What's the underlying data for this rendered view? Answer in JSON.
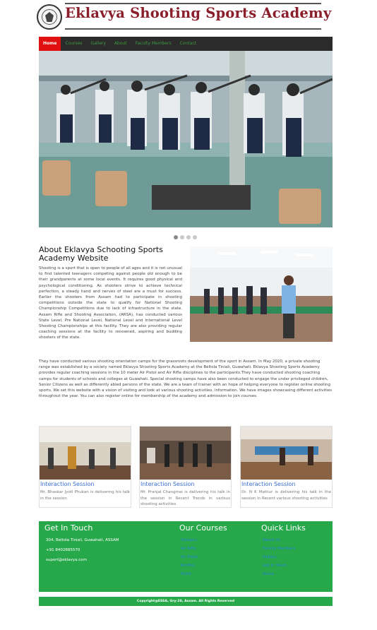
{
  "header": {
    "title": "Eklavya Shooting Sports Academy"
  },
  "nav": {
    "items": [
      "Home",
      "Courses",
      "Gallery",
      "About",
      "Faculty Members",
      "Contact"
    ],
    "active_index": 0
  },
  "slider": {
    "slide_count": 4,
    "active_index": 0
  },
  "about": {
    "heading": "About Eklavya Schooting Sports Academy Website",
    "para1": "Shooting is a sport that is open to people of all ages and it is not unusual to find talented teenagers competing against people old enough to be their grandparents at some local events. It requires good physical and psychological conditioning. As shooters strive to achieve technical perfection, a steady hand and nerves of steel are a must for success. Earlier the shooters from Assam had to participate in shooting competitions outside the state to qualify for National Shooting Championship Competitions due to lack of infrastructure in the state. Assam Rifle and Shooting Association, (ARSA), has conducted various State Level, Pre National Level, National Level and International Level Shooting Championships at this facility. They are also providing regular coaching sessions at the facility to renowned, aspiring and budding shooters of the state.",
    "para2": "They have conducted various shooting orientation camps for the grassroots development of the sport in Assam. In May 2020, a private shooting range was established by a society named Eklavya Shooting Sports Academy at the Beltola Tiniali, Guwahati. Eklavya Shooting Sports Academy provides regular coaching sessions in the 10 meter Air Pistol and Air Rifle disciplines to the participants.They have conducted shooting coaching camps for students of schools and colleges at Guwahati. Special shooting camps have also been conducted to engage the under privileged children, Senior Citizens as well as differently abled persons of the state. We are a team of trainer with an hope of helping everyone to register online shooting sports. We set this website with a vision of visiting and look at various shooting activities, information. We have images showcasing different activities throughout the year. You can also register online for membership of the academy and admission to join courses."
  },
  "cards": [
    {
      "title": "Interaction Session",
      "desc": "Mr. Bhaskar Jyoti Phukan is delivering his talk in the session"
    },
    {
      "title": "Interaction Session",
      "desc": "Mr. Pranjal Changmai is delivering his talk in the session in Recent Trends in various shooting activities"
    },
    {
      "title": "Interaction Session",
      "desc": "Dr. N K Mathur is delivering his talk in the session in Recent various shooting activities"
    }
  ],
  "footer": {
    "contact_heading": "Get In Touch",
    "address": "304, Beltola Tiniali, Guwahati, ASSAM",
    "phone": "+91 8402885570",
    "email": "suport@eklavya.com",
    "courses_heading": "Our Courses",
    "courses": [
      "Shotgun",
      "Air Rifle",
      "Air Pistol",
      "Rimfire",
      "Pistol"
    ],
    "links_heading": "Quick Links",
    "links": [
      "About Us",
      "Faculty Members",
      "Gallery",
      "Get In Touch",
      "Home"
    ],
    "copyright": "Copyright@ESSA, Gry-28, Assam. All Rights Reserved"
  },
  "colors": {
    "brand": "#8b1e2b",
    "nav_bg": "#2b2b2b",
    "nav_active": "#e01010",
    "footer_bg": "#27a84a",
    "link": "#3a6fcf"
  }
}
